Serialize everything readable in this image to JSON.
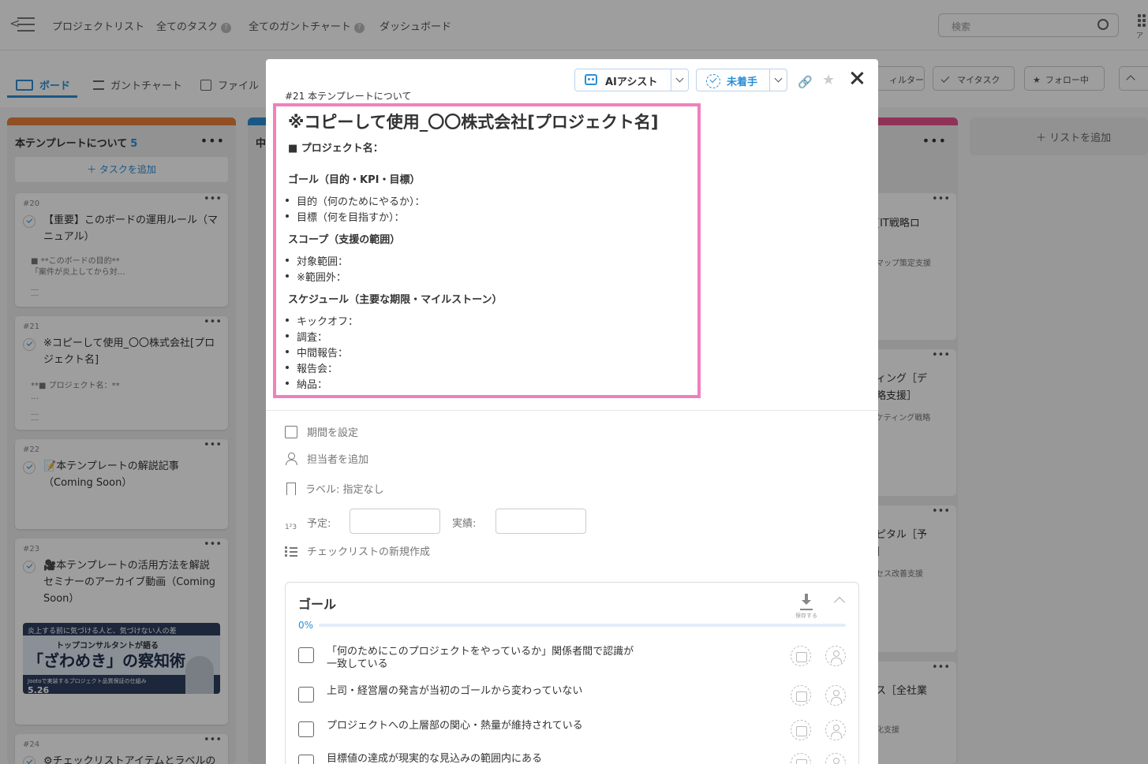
{
  "topbar": {
    "nav": [
      {
        "label": "プロジェクトリスト",
        "help": false
      },
      {
        "label": "全てのタスク",
        "help": true
      },
      {
        "label": "全てのガントチャート",
        "help": true
      },
      {
        "label": "ダッシュボード",
        "help": false
      }
    ],
    "help_glyph": "?",
    "back_glyph": "<",
    "search_placeholder": "検索",
    "apps_label": "ア"
  },
  "views": {
    "tabs": [
      {
        "label": "ボード",
        "active": true
      },
      {
        "label": "ガントチャート",
        "active": false
      },
      {
        "label": "ファイル",
        "active": false
      }
    ],
    "filters": [
      {
        "label": "ィルター"
      },
      {
        "label": "マイタスク"
      },
      {
        "label": "フォロー中"
      }
    ]
  },
  "board": {
    "columns": [
      {
        "title": "本テンプレートについて",
        "count": "5",
        "color": "#e8803a",
        "add_task": "＋ タスクを追加"
      },
      {
        "title": "中",
        "count": "",
        "color": "#2a8fd6",
        "add_task": ""
      },
      {
        "title": "",
        "count": "",
        "color": "#e8508f",
        "add_task": ""
      }
    ],
    "cards": [
      {
        "num": "#20",
        "title": "【重要】このボードの運用ルール（マニュアル）",
        "desc": "■ **このボードの目的**\n「案件が炎上してから対…"
      },
      {
        "num": "#21",
        "title": "※コピーして使用_〇〇株式会社[プロジェクト名]",
        "desc": "**■ プロジェクト名：**\n…"
      },
      {
        "num": "#22",
        "title": "📝本テンプレートの解説記事（Coming Soon）",
        "desc": ""
      },
      {
        "num": "#23",
        "title": "🎥本テンプレートの活用方法を解説セミナーのアーカイブ動画（Coming Soon）",
        "desc": ""
      },
      {
        "num": "#24",
        "title": "⚙チェックリストアイテムとラベルの",
        "desc": ""
      }
    ],
    "banner": {
      "line1": "炎上する前に気づける人と、気づけない人の差",
      "line2": "トップコンサルタントが語る",
      "line3": "「ざわめき」の察知術",
      "line4": "Jootoで実装するプロジェクト品質保証の仕組み",
      "date": "5.26"
    },
    "right_cards": [
      {
        "title": "[IT戦略ロ",
        "sub": "マップ策定支援"
      },
      {
        "title": "ィング［デ",
        "title2": "略支援］",
        "sub": "ケティング戦略"
      },
      {
        "title": "ピタル［予",
        "title2": "］",
        "sub": "セス改善支援"
      },
      {
        "title": "ス［全社業",
        "sub": "化支援"
      }
    ],
    "add_list": "＋  リストを追加"
  },
  "modal": {
    "ai_assist": "AIアシスト",
    "status": "未着手",
    "breadcrumb": "#21 本テンプレートについて",
    "title": "※コピーして使用_〇〇株式会社[プロジェクト名]",
    "project_name": "■ プロジェクト名：",
    "sections": [
      {
        "heading": "ゴール（目的・KPI・目標）",
        "items": [
          "目的（何のためにやるか）：",
          "目標（何を目指すか）："
        ]
      },
      {
        "heading": "スコープ（支援の範囲）",
        "items": [
          "対象範囲：",
          "※範囲外："
        ]
      },
      {
        "heading": "スケジュール（主要な期限・マイルストーン）",
        "items": [
          "キックオフ：",
          "調査：",
          "中間報告：",
          "報告会：",
          "納品："
        ]
      }
    ],
    "meta": {
      "period": "期間を設定",
      "assignee": "担当者を追加",
      "label": "ラベル: 指定なし",
      "planned": "予定:",
      "actual": "実績:",
      "new_checklist": "チェックリストの新規作成"
    },
    "checklist": {
      "title": "ゴール",
      "save": "保存する",
      "progress_label": "0%",
      "progress": 0,
      "items": [
        "「何のためにこのプロジェクトをやっているか」関係者間で認識が一致している",
        "上司・経営層の発言が当初のゴールから変わっていない",
        "プロジェクトへの上層部の関心・熱量が維持されている",
        "目標値の達成が現実的な見込みの範囲内にある"
      ]
    }
  }
}
